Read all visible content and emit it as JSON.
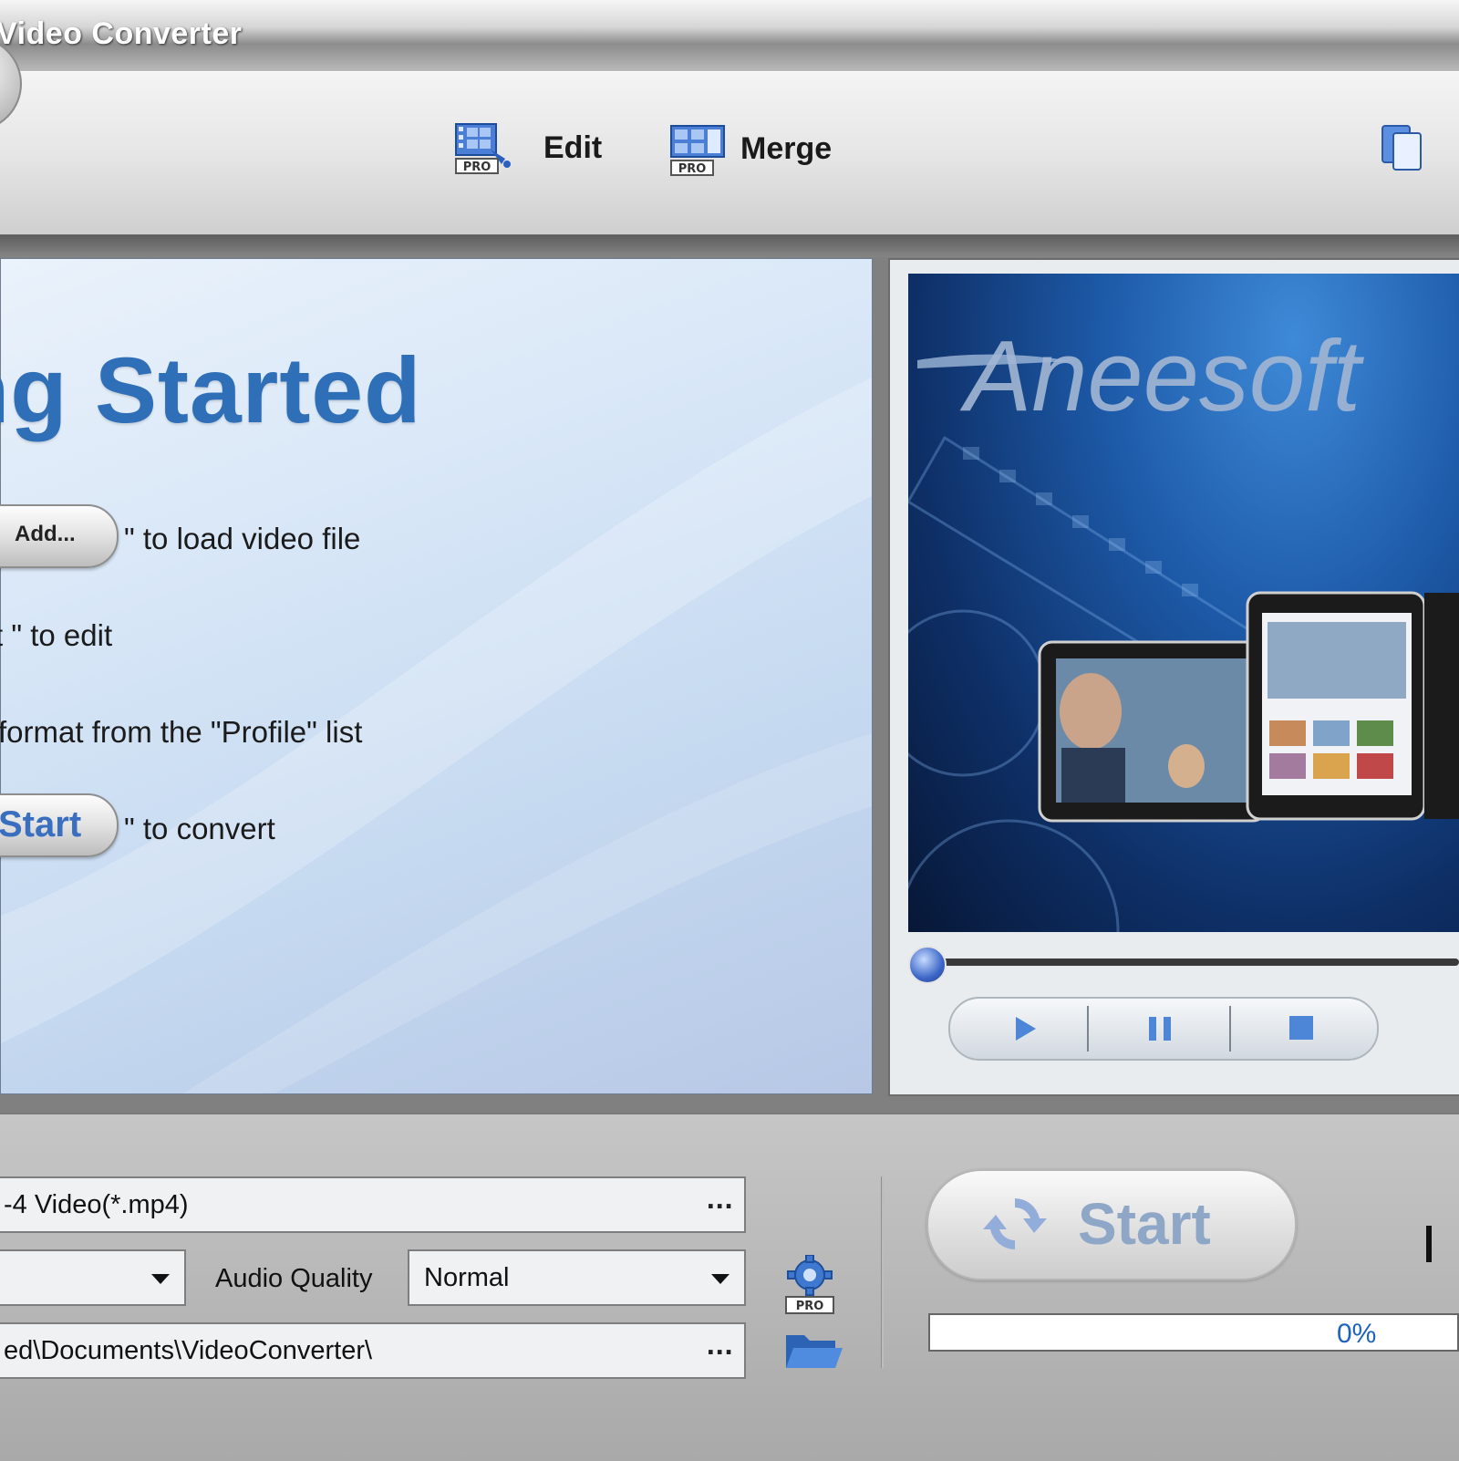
{
  "window": {
    "title": "Video Converter"
  },
  "toolbar": {
    "edit": {
      "label": "Edit",
      "badge": "PRO",
      "icon": "film-edit-icon"
    },
    "merge": {
      "label": "Merge",
      "badge": "PRO",
      "icon": "film-merge-icon"
    },
    "clipboard_icon": "clipboard-icon"
  },
  "getting_started": {
    "title": "ng Started",
    "steps": [
      {
        "button": "Add...",
        "text": "\" to load video file"
      },
      {
        "text": "t \" to edit"
      },
      {
        "text": "format from the \"Profile\" list"
      },
      {
        "button": "Start",
        "text": "\" to convert"
      }
    ]
  },
  "preview": {
    "brand": "Aneesoft",
    "position": 0
  },
  "player": {
    "buttons": [
      "play-icon",
      "pause-icon",
      "stop-icon"
    ]
  },
  "output": {
    "profile": "-4 Video(*.mp4)",
    "profile_more": "...",
    "video_quality": "",
    "audio_quality_label": "Audio Quality",
    "audio_quality": "Normal",
    "folder": "ed\\Documents\\VideoConverter\\",
    "folder_more": "...",
    "settings_badge": "PRO"
  },
  "convert": {
    "start_label": "Start",
    "progress": "0%",
    "progress_value": 0
  },
  "colors": {
    "accent": "#2f6fb8",
    "progress_text": "#1f63c0",
    "start_label": "#8fa7c7"
  }
}
